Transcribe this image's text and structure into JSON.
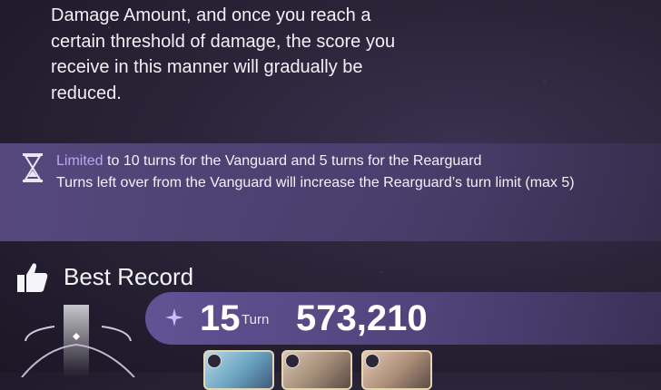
{
  "description": {
    "text": "Damage Amount, and once you reach a\ncertain threshold of damage, the score you\nreceive in this manner will gradually be\nreduced."
  },
  "turn_limit": {
    "icon": "hourglass-icon",
    "highlight_word": "Limited",
    "line1_rest": " to 10 turns for the Vanguard and 5 turns for the Rearguard",
    "line2": "Turns left over from the Vanguard will increase the Rearguard’s turn limit (max 5)"
  },
  "best_record": {
    "icon": "thumbs-up-icon",
    "title": "Best Record",
    "turns": "15",
    "turn_label": "Turn",
    "score": "573,210"
  },
  "team": {
    "members": [
      {
        "name": "character-portrait-1"
      },
      {
        "name": "character-portrait-2"
      },
      {
        "name": "character-portrait-3"
      }
    ]
  },
  "colors": {
    "accent": "#b9a9f5",
    "panel": "#5f508c"
  }
}
